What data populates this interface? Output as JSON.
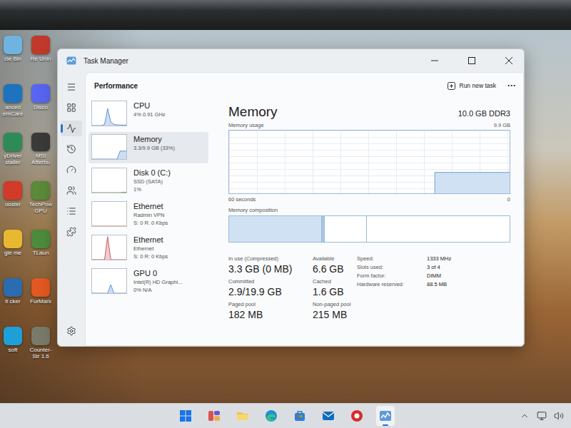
{
  "window": {
    "title": "Task Manager"
  },
  "nav": [
    {
      "kind": "menu",
      "selected": false
    },
    {
      "kind": "processes",
      "selected": false
    },
    {
      "kind": "performance",
      "selected": true
    },
    {
      "kind": "history",
      "selected": false
    },
    {
      "kind": "startup",
      "selected": false
    },
    {
      "kind": "users",
      "selected": false
    },
    {
      "kind": "details",
      "selected": false
    },
    {
      "kind": "services",
      "selected": false
    }
  ],
  "nav_bottom": {
    "kind": "settings",
    "selected": false
  },
  "header": {
    "title": "Performance",
    "run_task": "Run new task",
    "more": "···"
  },
  "devices": [
    {
      "name": "CPU",
      "lines": [
        "4% 0.91 GHz"
      ],
      "selected": false,
      "color": "#5b8fd6",
      "graph": [
        0,
        0,
        0,
        0,
        0.05,
        0.7,
        0.15,
        0.05,
        0.03,
        0.02,
        0.02,
        0.02
      ]
    },
    {
      "name": "Memory",
      "lines": [
        "3.3/9.9 GB (33%)"
      ],
      "selected": true,
      "color": "#5b8fd6",
      "graph": [
        0,
        0,
        0,
        0,
        0,
        0,
        0,
        0,
        0,
        0.33,
        0.33,
        0.33
      ]
    },
    {
      "name": "Disk 0 (C:)",
      "lines": [
        "SSD (SATA)",
        "1%"
      ],
      "selected": false,
      "color": "#5da85d",
      "graph": [
        0,
        0,
        0,
        0,
        0,
        0,
        0,
        0,
        0,
        0,
        0.02,
        0.01
      ]
    },
    {
      "name": "Ethernet",
      "lines": [
        "Radmin VPN",
        "S: 0 R: 0 Kbps"
      ],
      "selected": false,
      "color": "#c8742f",
      "graph": [
        0,
        0,
        0,
        0,
        0,
        0,
        0,
        0,
        0,
        0,
        0,
        0
      ]
    },
    {
      "name": "Ethernet",
      "lines": [
        "Ethernet",
        "S: 0 R: 0 Kbps"
      ],
      "selected": false,
      "color": "#d0505a",
      "graph": [
        0,
        0,
        0,
        0,
        0,
        0.95,
        0,
        0,
        0,
        0,
        0,
        0
      ]
    },
    {
      "name": "GPU 0",
      "lines": [
        "Intel(R) HD Graphi...",
        "0% N/A"
      ],
      "selected": false,
      "color": "#5b8fd6",
      "graph": [
        0,
        0,
        0,
        0,
        0,
        0,
        0.35,
        0,
        0,
        0,
        0,
        0
      ]
    }
  ],
  "detail": {
    "title": "Memory",
    "spec": "10.0 GB DDR3",
    "usage_label": "Memory usage",
    "max_label": "9.9 GB",
    "time_left": "60 seconds",
    "time_right": "0",
    "composition_label": "Memory composition"
  },
  "chart": {
    "max": 9.9,
    "seconds": 60,
    "values": [
      3.3,
      3.3,
      3.3,
      3.3,
      3.3,
      3.3,
      3.3,
      3.3,
      3.3,
      3.3,
      3.3,
      3.3,
      3.3,
      3.3,
      3.3,
      3.3,
      3.3
    ]
  },
  "composition": [
    {
      "kind": "in-use",
      "level": 0.33
    },
    {
      "kind": "modified",
      "level": 0.01
    },
    {
      "kind": "standby",
      "level": 0.15
    },
    {
      "kind": "free",
      "level": 0.51
    }
  ],
  "stats": [
    {
      "label": "In use (Compressed)",
      "value": "3.3 GB (0 MB)"
    },
    {
      "label": "Available",
      "value": "6.6 GB"
    },
    {
      "label": "Committed",
      "value": "2.9/19.9 GB"
    },
    {
      "label": "Cached",
      "value": "1.6 GB"
    },
    {
      "label": "Paged pool",
      "value": "182 MB"
    },
    {
      "label": "Non-paged pool",
      "value": "215 MB"
    }
  ],
  "specs": [
    {
      "label": "Speed:",
      "value": "1333 MHz"
    },
    {
      "label": "Slots used:",
      "value": "3 of 4"
    },
    {
      "label": "Form factor:",
      "value": "DIMM"
    },
    {
      "label": "Hardware reserved:",
      "value": "88.5 MB"
    }
  ],
  "desktop_icons": [
    {
      "label": "cle Bin",
      "color": "#6fb3e0"
    },
    {
      "label": "Re Unin",
      "color": "#c0392b"
    },
    {
      "label": "anced emCare",
      "color": "#1e73be"
    },
    {
      "label": "Disco",
      "color": "#5865f2"
    },
    {
      "label": "yDriver staller",
      "color": "#2e8b57"
    },
    {
      "label": "MSI Afterbu",
      "color": "#3a3a3a"
    },
    {
      "label": "ooster",
      "color": "#d23a2a"
    },
    {
      "label": "TechPow GPU",
      "color": "#5a8a3a"
    },
    {
      "label": "gle me",
      "color": "#e8b830"
    },
    {
      "label": "TLaun",
      "color": "#4c8c3c"
    },
    {
      "label": "it cker",
      "color": "#2b6cb0"
    },
    {
      "label": "FurMark",
      "color": "#e25822"
    },
    {
      "label": "soft",
      "color": "#1e9fd9"
    },
    {
      "label": "Counter-Str 1.6",
      "color": "#7a7a6a"
    }
  ],
  "taskbar": {
    "items": [
      {
        "kind": "start",
        "selected": false
      },
      {
        "kind": "widgets",
        "selected": false
      },
      {
        "kind": "explorer",
        "selected": false
      },
      {
        "kind": "edge",
        "selected": false
      },
      {
        "kind": "store",
        "selected": false
      },
      {
        "kind": "mail",
        "selected": false
      },
      {
        "kind": "app",
        "selected": false
      },
      {
        "kind": "taskmanager",
        "selected": true
      }
    ],
    "tray": [
      {
        "kind": "chevron"
      },
      {
        "kind": "monitor"
      },
      {
        "kind": "volume"
      }
    ]
  }
}
